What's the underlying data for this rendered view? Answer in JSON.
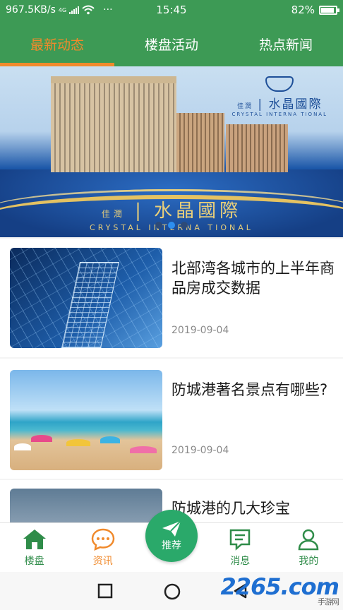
{
  "status_bar": {
    "speed": "967.5KB/s",
    "network": "4G",
    "more": "···",
    "time": "15:45",
    "battery": "82%"
  },
  "tabs": [
    {
      "label": "最新动态",
      "active": true
    },
    {
      "label": "楼盘活动",
      "active": false
    },
    {
      "label": "热点新闻",
      "active": false
    }
  ],
  "banner": {
    "brand_cn": "水晶國際",
    "brand_prefix": "佳潤",
    "brand_en": "CRYSTAL INTERNA TIONAL",
    "slides": 3,
    "active_slide": 2
  },
  "news": [
    {
      "title": "北部湾各城市的上半年商品房成交数据",
      "date": "2019-09-04"
    },
    {
      "title": "防城港著名景点有哪些?",
      "date": "2019-09-04"
    },
    {
      "title": "防城港的几大珍宝",
      "date": ""
    }
  ],
  "bottom_nav": {
    "home": "楼盘",
    "info": "资讯",
    "recommend": "推荐",
    "messages": "消息",
    "mine": "我的"
  },
  "watermark": {
    "text": "2265.com",
    "sub": "手游网"
  },
  "colors": {
    "primary": "#3d9a55",
    "accent": "#f08a2c",
    "fab": "#2aa96a"
  }
}
